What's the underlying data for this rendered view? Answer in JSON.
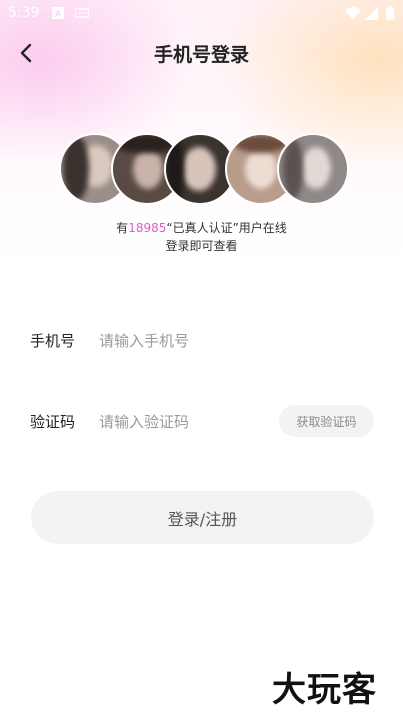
{
  "status_bar": {
    "time": "5:39"
  },
  "header": {
    "title": "手机号登录"
  },
  "online": {
    "prefix": "有",
    "count": "18985",
    "suffix": "“已真人认证”用户在线",
    "line2": "登录即可查看"
  },
  "form": {
    "phone_label": "手机号",
    "phone_placeholder": "请输入手机号",
    "code_label": "验证码",
    "code_placeholder": "请输入验证码",
    "get_code_label": "获取验证码"
  },
  "login_button": "登录/注册",
  "watermark": "大玩客",
  "colors": {
    "highlight": "#e05cc8",
    "button_bg": "#f3f3f3"
  }
}
